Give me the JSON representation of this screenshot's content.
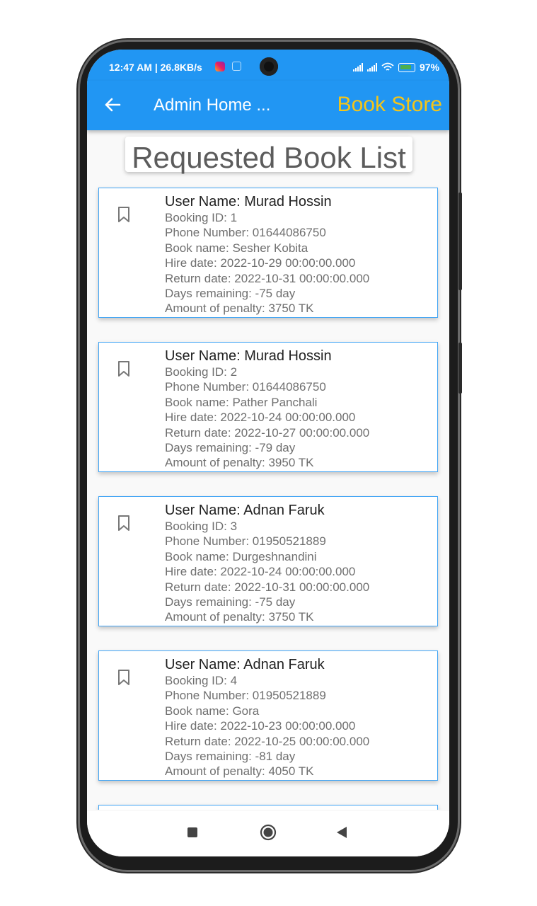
{
  "status_bar": {
    "time": "12:47 AM | 26.8KB/s",
    "battery": "97%"
  },
  "app_bar": {
    "title": "Admin Home ...",
    "brand": "Book Store"
  },
  "page": {
    "heading": "Requested Book List"
  },
  "bookings": [
    {
      "user": "User Name: Murad Hossin",
      "lines": [
        "Booking ID: 1",
        "Phone Number: 01644086750",
        "Book name: Sesher Kobita",
        "Hire date: 2022-10-29 00:00:00.000",
        "Return date: 2022-10-31 00:00:00.000",
        "Days remaining: -75 day",
        "Amount of penalty: 3750 TK"
      ]
    },
    {
      "user": "User Name: Murad Hossin",
      "lines": [
        "Booking ID: 2",
        "Phone Number: 01644086750",
        "Book name: Pather Panchali",
        "Hire date: 2022-10-24 00:00:00.000",
        "Return date: 2022-10-27 00:00:00.000",
        "Days remaining: -79 day",
        "Amount of penalty: 3950 TK"
      ]
    },
    {
      "user": "User Name: Adnan Faruk",
      "lines": [
        "Booking ID: 3",
        "Phone Number: 01950521889",
        "Book name: Durgeshnandini",
        "Hire date: 2022-10-24 00:00:00.000",
        "Return date: 2022-10-31 00:00:00.000",
        "Days remaining: -75 day",
        "Amount of penalty: 3750 TK"
      ]
    },
    {
      "user": "User Name: Adnan Faruk",
      "lines": [
        "Booking ID: 4",
        "Phone Number: 01950521889",
        "Book name: Gora",
        "Hire date: 2022-10-23 00:00:00.000",
        "Return date: 2022-10-25 00:00:00.000",
        "Days remaining: -81 day",
        "Amount of penalty: 4050 TK"
      ]
    },
    {
      "user": "",
      "lines": []
    }
  ],
  "icons": {
    "back": "arrow-left-icon",
    "bookmark": "bookmark-outline-icon",
    "nav_recents": "square-icon",
    "nav_home": "circle-icon",
    "nav_back": "triangle-back-icon"
  },
  "colors": {
    "primary": "#2196f3",
    "brand": "#f5c518",
    "card_border": "#42a5f5"
  }
}
